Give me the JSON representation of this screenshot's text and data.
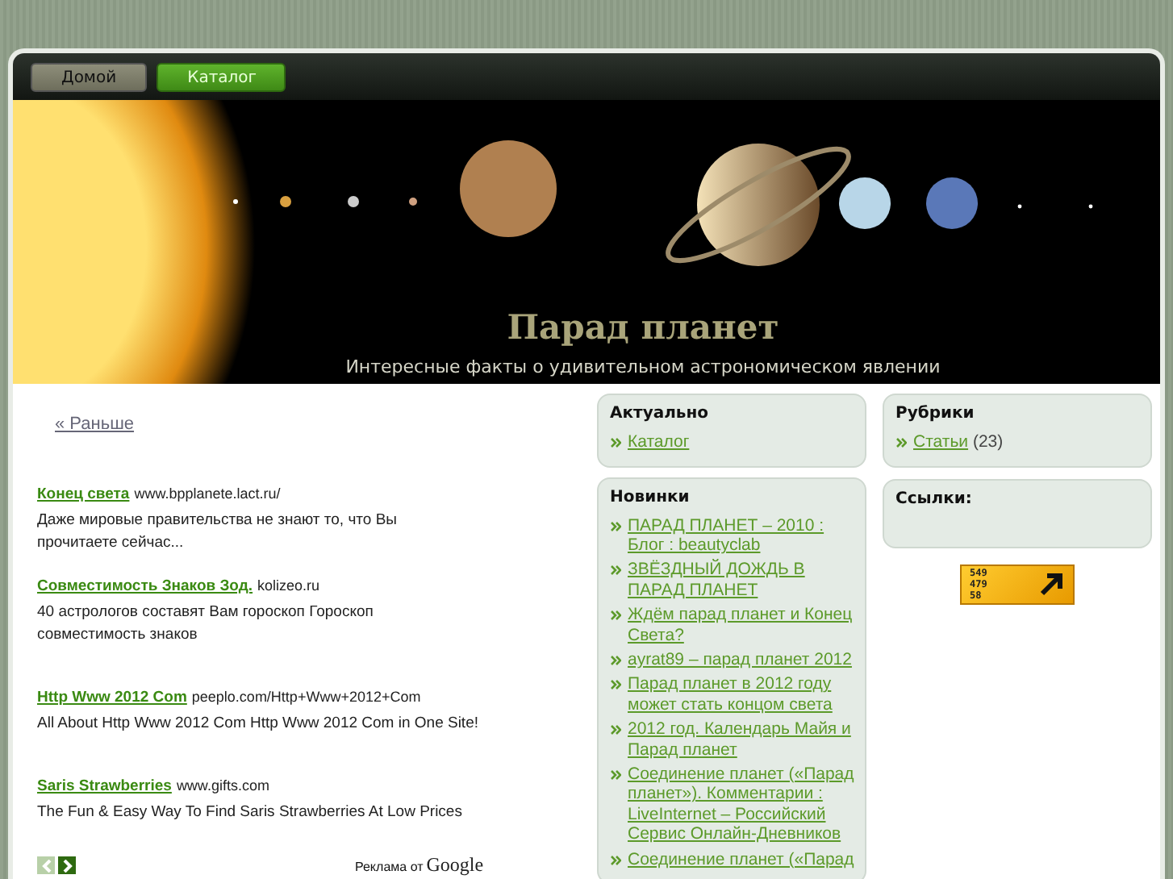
{
  "nav": {
    "tabs": [
      {
        "label": "Домой",
        "selected": false
      },
      {
        "label": "Каталог",
        "selected": true
      }
    ]
  },
  "header": {
    "title": "Парад планет",
    "subtitle": "Интересные факты о удивительном астрономическом явлении"
  },
  "older_link": "« Раньше",
  "ads": [
    {
      "title": "Конец света",
      "url": "www.bpplanete.lact.ru/",
      "text": "Даже мировые правительства не знают то, что Вы прочитаете сейчас..."
    },
    {
      "title": "Совместимость Знаков Зод.",
      "url": "kolizeo.ru",
      "text": "40 астрологов составят Вам гороскоп Гороскоп совместимость знаков"
    },
    {
      "title": "Http Www 2012 Com",
      "url": "peeplo.com/Http+Www+2012+Com",
      "text": "All About Http Www 2012 Com Http Www 2012 Com in One Site!"
    },
    {
      "title": "Saris Strawberries",
      "url": "www.gifts.com",
      "text": "The Fun & Easy Way To Find Saris Strawberries At Low Prices"
    }
  ],
  "ad_pager": {
    "prev_disabled": true,
    "next_disabled": false
  },
  "ad_label": "Реклама от",
  "ad_brand": "Google",
  "middle_sidebar": [
    {
      "title": "Актуально",
      "items": [
        {
          "label": "Каталог"
        }
      ]
    },
    {
      "title": "Новинки",
      "items": [
        {
          "label": "ПАРАД ПЛАНЕТ – 2010 : Блог : beautyclab"
        },
        {
          "label": "ЗВЁЗДНЫЙ ДОЖДЬ В ПАРАД ПЛАНЕТ"
        },
        {
          "label": "Ждём парад планет и Конец Света?"
        },
        {
          "label": "ayrat89 – парад планет 2012"
        },
        {
          "label": "Парад планет в 2012 году может стать концом света"
        },
        {
          "label": "2012 год. Календарь Майя и Парад планет"
        },
        {
          "label": "Соединение планет («Парад планет»). Комментарии : LiveInternet – Российский Сервис Онлайн-Дневников"
        },
        {
          "label": "Соединение планет («Парад"
        }
      ]
    }
  ],
  "right_sidebar": [
    {
      "title": "Рубрики",
      "items": [
        {
          "label": "Статьи",
          "count": "(23)"
        }
      ]
    },
    {
      "title": "Ссылки:"
    }
  ],
  "counter": [
    "549",
    "479",
    "58"
  ]
}
